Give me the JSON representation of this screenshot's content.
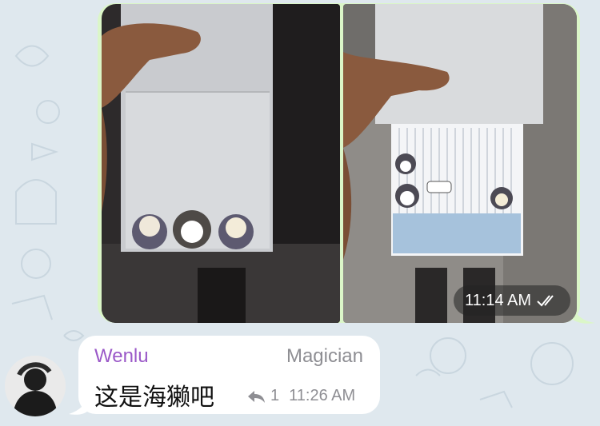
{
  "colors": {
    "wallpaper": "#dfe8ee",
    "outgoing_bubble": "#dbf6c8",
    "incoming_bubble": "#ffffff",
    "sender_name": "#9b59c8",
    "meta_text": "#8e8e93"
  },
  "album": {
    "photos": [
      {
        "icon": "photo-sticky-notes-in-hand"
      },
      {
        "icon": "photo-sticky-notes-open"
      }
    ],
    "time": "11:14 AM",
    "status_icon": "double-check-icon"
  },
  "message": {
    "avatar_icon": "avatar",
    "sender": "Wenlu",
    "role": "Magician",
    "text": "这是海獭吧",
    "reply_icon": "reply-arrow-icon",
    "reply_count": "1",
    "time": "11:26 AM"
  }
}
